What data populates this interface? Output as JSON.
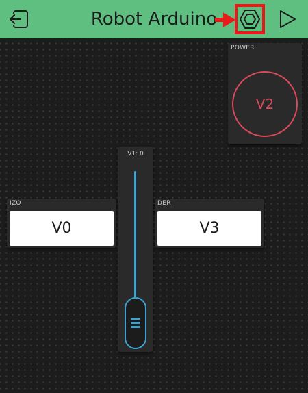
{
  "header": {
    "title": "Robot Arduino",
    "exit_icon": "exit-icon",
    "settings_icon": "hexagon-nut-settings-icon",
    "play_icon": "play-icon",
    "bar_color": "#5ebf80",
    "highlight_color": "#e81b1b"
  },
  "widgets": {
    "power": {
      "label": "POWER",
      "pin": "V2",
      "color": "#d94a5c"
    },
    "slider": {
      "label": "V1: 0",
      "value": 0,
      "color": "#3fa3d1"
    },
    "izq": {
      "label": "IZQ",
      "value": "V0"
    },
    "der": {
      "label": "DER",
      "value": "V3"
    }
  }
}
